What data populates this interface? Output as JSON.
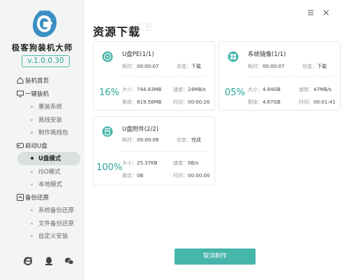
{
  "app": {
    "name": "极客狗装机大师",
    "version": "v.1.0.0.30"
  },
  "sidebar": {
    "items": [
      {
        "kind": "section",
        "label": "装机首页",
        "icon": "home-icon"
      },
      {
        "kind": "section",
        "label": "一键装机",
        "icon": "monitor-icon"
      },
      {
        "kind": "sub",
        "label": "重装系统"
      },
      {
        "kind": "sub",
        "label": "离线安装"
      },
      {
        "kind": "sub",
        "label": "制作离线包"
      },
      {
        "kind": "section",
        "label": "启动U盘",
        "icon": "usb-drive-icon"
      },
      {
        "kind": "sub",
        "label": "U盘模式",
        "active": true
      },
      {
        "kind": "sub",
        "label": "ISO模式"
      },
      {
        "kind": "sub",
        "label": "本地模式"
      },
      {
        "kind": "section",
        "label": "备份还原",
        "icon": "backup-icon"
      },
      {
        "kind": "sub",
        "label": "系统备份还原"
      },
      {
        "kind": "sub",
        "label": "文件备份还原"
      },
      {
        "kind": "sub",
        "label": "自定义安装"
      }
    ],
    "bottom_icons": [
      "ie-browser-icon",
      "qq-icon",
      "wechat-icon"
    ]
  },
  "main": {
    "title": "资源下载",
    "title_watermark": "CE",
    "window_controls": {
      "menu_icon": "menu-icon",
      "close_icon": "close-icon"
    },
    "labels": {
      "elapsed": "耗时：",
      "status": "状态：",
      "size": "大小：",
      "speed": "速度：",
      "remaining": "剩余：",
      "time": "时间："
    },
    "cards": [
      {
        "name": "U盘PE(1/1)",
        "icon": "disc-icon",
        "elapsed": "00:00:07",
        "status": "下载",
        "percent": "16%",
        "size": "744.83MB",
        "speed": "24MB/s",
        "remaining": "619.58MB",
        "time": "00:00:26"
      },
      {
        "name": "系统镜像(1/1)",
        "icon": "windows-icon",
        "elapsed": "00:00:07",
        "status": "下载",
        "percent": "05%",
        "size": "4.94GB",
        "speed": "47MB/s",
        "remaining": "4.67GB",
        "time": "00:01:41"
      },
      {
        "name": "U盘附件(2/2)",
        "icon": "usb-file-icon",
        "elapsed": "00:00:06",
        "status": "完成",
        "percent": "100%",
        "size": "25.37KB",
        "speed": "0B/s",
        "remaining": "0B",
        "time": "00:00:00"
      }
    ],
    "cancel_button": "取消制作"
  },
  "colors": {
    "accent": "#2aa598",
    "button": "#46b5aa",
    "logo": "#3c8fc4"
  }
}
